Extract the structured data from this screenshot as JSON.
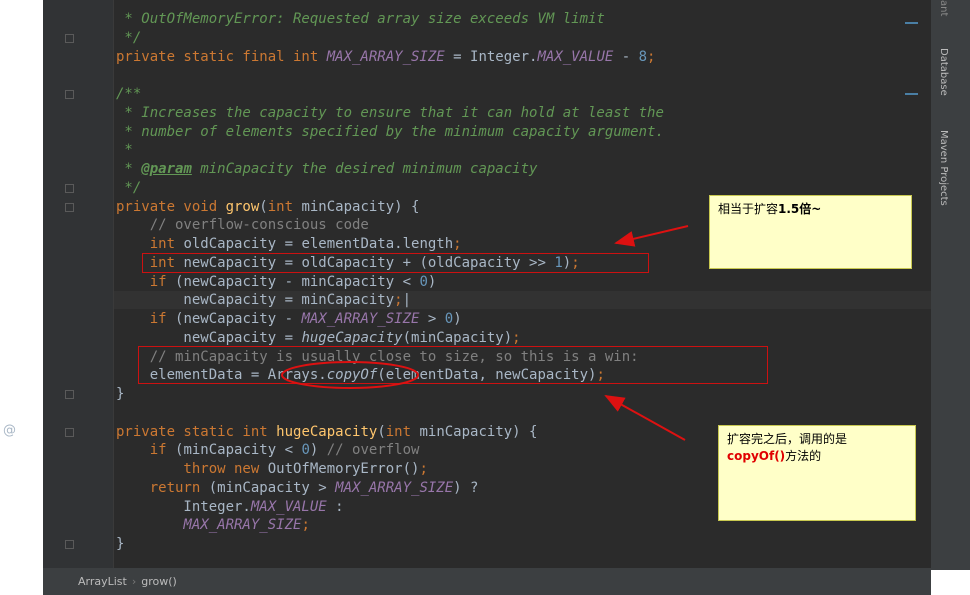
{
  "editor": {
    "lines": [
      {
        "parts": [
          [
            "c",
            " * OutOfMemoryError: Requested array size exceeds VM limit"
          ]
        ]
      },
      {
        "parts": [
          [
            "c",
            " */"
          ]
        ]
      },
      {
        "parts": [
          [
            "k",
            "private static final int "
          ],
          [
            "st",
            "MAX_ARRAY_SIZE"
          ],
          [
            "",
            " = Integer."
          ],
          [
            "st",
            "MAX_VALUE"
          ],
          [
            "",
            " - "
          ],
          [
            "nm",
            "8"
          ],
          [
            "k",
            ";"
          ]
        ]
      },
      {
        "parts": [
          [
            "",
            ""
          ]
        ]
      },
      {
        "parts": [
          [
            "c",
            "/**"
          ]
        ]
      },
      {
        "parts": [
          [
            "c",
            " * Increases the capacity to ensure that it can hold at least the"
          ]
        ]
      },
      {
        "parts": [
          [
            "c",
            " * number of elements specified by the minimum capacity argument."
          ]
        ]
      },
      {
        "parts": [
          [
            "c",
            " *"
          ]
        ]
      },
      {
        "parts": [
          [
            "c",
            " * "
          ],
          [
            "tag",
            "@param"
          ],
          [
            "c",
            " minCapacity the desired minimum capacity"
          ]
        ]
      },
      {
        "parts": [
          [
            "c",
            " */"
          ]
        ]
      },
      {
        "parts": [
          [
            "k",
            "private void "
          ],
          [
            "fn",
            "grow"
          ],
          [
            "",
            "("
          ],
          [
            "k",
            "int "
          ],
          [
            "",
            "minCapacity) {"
          ]
        ]
      },
      {
        "parts": [
          [
            "lc",
            "    // overflow-conscious code"
          ]
        ]
      },
      {
        "parts": [
          [
            "k",
            "    int "
          ],
          [
            "",
            "oldCapacity = elementData.length"
          ],
          [
            "k",
            ";"
          ]
        ]
      },
      {
        "parts": [
          [
            "k",
            "    int "
          ],
          [
            "",
            "newCapacity = oldCapacity + (oldCapacity >> "
          ],
          [
            "nm",
            "1"
          ],
          [
            "",
            ")"
          ],
          [
            "k",
            ";"
          ]
        ]
      },
      {
        "parts": [
          [
            "k",
            "    if "
          ],
          [
            "",
            "(newCapacity - minCapacity < "
          ],
          [
            "nm",
            "0"
          ],
          [
            "",
            ")"
          ]
        ]
      },
      {
        "parts": [
          [
            "",
            "        newCapacity = minCapacity"
          ],
          [
            "k",
            ";"
          ],
          [
            "",
            "|"
          ]
        ]
      },
      {
        "parts": [
          [
            "k",
            "    if "
          ],
          [
            "",
            "(newCapacity - "
          ],
          [
            "st",
            "MAX_ARRAY_SIZE"
          ],
          [
            "",
            " > "
          ],
          [
            "nm",
            "0"
          ],
          [
            "",
            ")"
          ]
        ]
      },
      {
        "parts": [
          [
            "",
            "        newCapacity = "
          ],
          [
            "it",
            "hugeCapacity"
          ],
          [
            "",
            "(minCapacity)"
          ],
          [
            "k",
            ";"
          ]
        ]
      },
      {
        "parts": [
          [
            "lc",
            "    // minCapacity is usually close to size, so this is a win:"
          ]
        ]
      },
      {
        "parts": [
          [
            "",
            "    elementData = Arrays."
          ],
          [
            "it",
            "copyOf"
          ],
          [
            "",
            "(elementData, newCapacity)"
          ],
          [
            "k",
            ";"
          ]
        ]
      },
      {
        "parts": [
          [
            "",
            "}"
          ]
        ]
      },
      {
        "parts": [
          [
            "",
            ""
          ]
        ]
      },
      {
        "parts": [
          [
            "k",
            "private static int "
          ],
          [
            "fn",
            "hugeCapacity"
          ],
          [
            "",
            "("
          ],
          [
            "k",
            "int "
          ],
          [
            "",
            "minCapacity) {"
          ]
        ]
      },
      {
        "parts": [
          [
            "k",
            "    if "
          ],
          [
            "",
            "(minCapacity < "
          ],
          [
            "nm",
            "0"
          ],
          [
            "",
            ") "
          ],
          [
            "lc",
            "// overflow"
          ]
        ]
      },
      {
        "parts": [
          [
            "k",
            "        throw new "
          ],
          [
            "",
            "OutOfMemoryError()"
          ],
          [
            "k",
            ";"
          ]
        ]
      },
      {
        "parts": [
          [
            "k",
            "    return "
          ],
          [
            "",
            "(minCapacity > "
          ],
          [
            "st",
            "MAX_ARRAY_SIZE"
          ],
          [
            "",
            ") ?"
          ]
        ]
      },
      {
        "parts": [
          [
            "",
            "        Integer."
          ],
          [
            "st",
            "MAX_VALUE"
          ],
          [
            "",
            " :"
          ]
        ]
      },
      {
        "parts": [
          [
            "st",
            "        MAX_ARRAY_SIZE"
          ],
          [
            "k",
            ";"
          ]
        ]
      },
      {
        "parts": [
          [
            "",
            "}"
          ]
        ]
      }
    ]
  },
  "gutter": {
    "at_mark": "@"
  },
  "right_panel": {
    "tabs": [
      "Database",
      "Maven Projects"
    ],
    "top_tab": "ant"
  },
  "breadcrumb": {
    "items": [
      "ArrayList",
      "grow()"
    ]
  },
  "annotations": {
    "note1": {
      "text": "相当于扩容",
      "bold": "1.5倍~"
    },
    "note2": {
      "line1": "扩容完之后，调用的是",
      "red": "copyOf()",
      "after": "方法的"
    }
  },
  "colors": {
    "annotation_red": "#cc1111",
    "note_bg": "#ffffc8"
  }
}
